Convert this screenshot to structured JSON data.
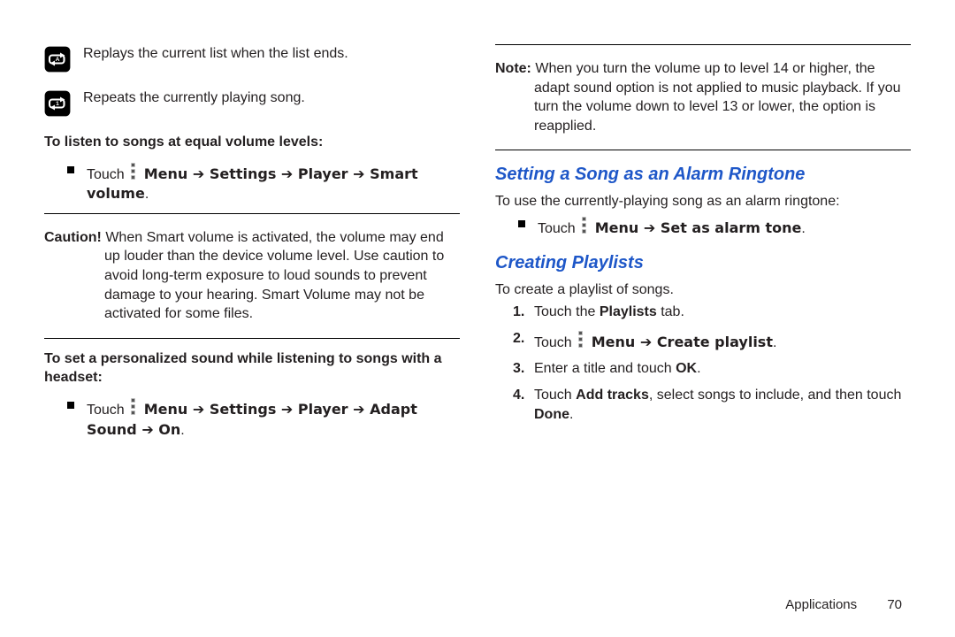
{
  "left": {
    "repeat_all": "Replays the current list when the list ends.",
    "repeat_one": "Repeats the currently playing song.",
    "equal_volume_head": "To listen to songs at equal volume levels:",
    "touch": "Touch ",
    "menu_smart_volume": " Menu ➔ Settings ➔ Player ➔ Smart volume",
    "caution_label": "Caution!",
    "caution_body": " When Smart volume is activated, the volume may end up louder than the device volume level. Use caution to avoid long-term exposure to loud sounds to prevent damage to your hearing. Smart Volume may not be activated for some files.",
    "adapt_head": "To set a personalized sound while listening to songs with a headset:",
    "menu_adapt": " Menu ➔ Settings ➔ Player ➔ Adapt Sound ➔ On"
  },
  "right": {
    "note_label": "Note:",
    "note_body": " When you turn the volume up to level 14 or higher, the adapt sound option is not applied to music playback. If you turn the volume down to level 13 or lower, the option is reapplied.",
    "alarm_title": "Setting a Song as an Alarm Ringtone",
    "alarm_intro": "To use the currently-playing song as an alarm ringtone:",
    "menu_alarm": " Menu ➔ Set as alarm tone",
    "playlist_title": "Creating Playlists",
    "playlist_intro": "To create a playlist of songs.",
    "step1_a": "Touch the ",
    "step1_b": "Playlists",
    "step1_c": " tab.",
    "step2_a": "Touch ",
    "step2_b": " Menu ➔ Create playlist",
    "step3_a": "Enter a title and touch ",
    "step3_b": "OK",
    "step4_a": "Touch ",
    "step4_b": "Add tracks",
    "step4_c": ", select songs to include, and then touch ",
    "step4_d": "Done"
  },
  "footer": {
    "section": "Applications",
    "page": "70"
  }
}
